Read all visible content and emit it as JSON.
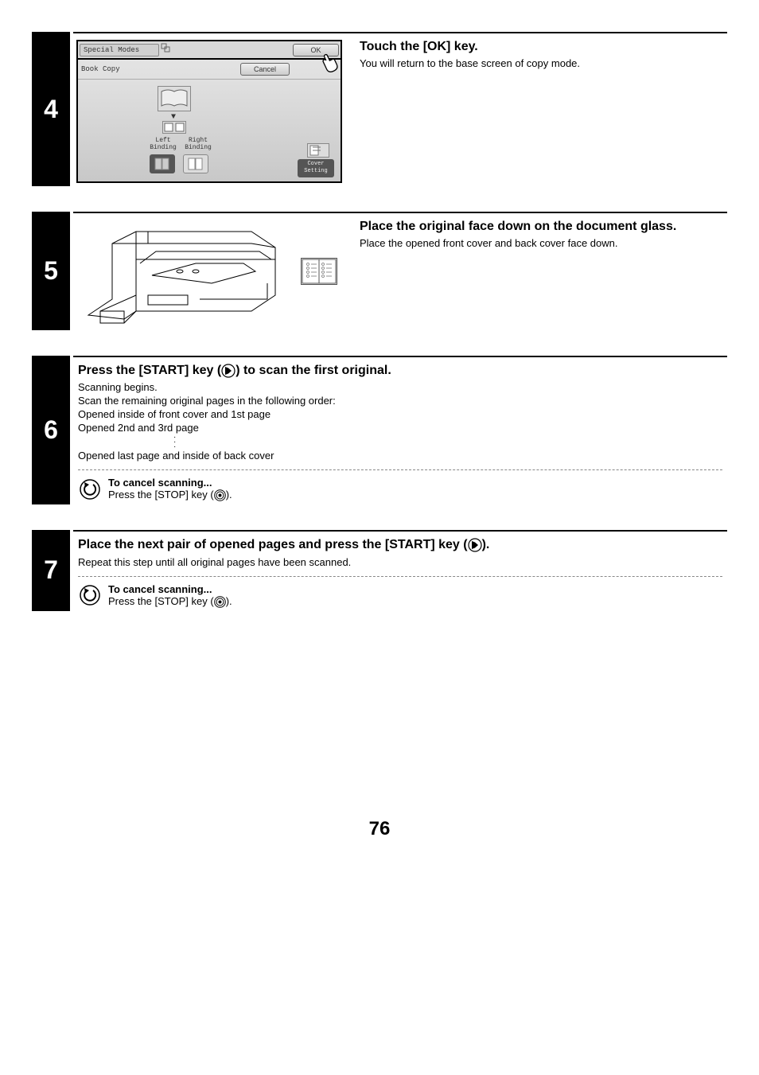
{
  "steps": {
    "4": {
      "number": "4",
      "heading": "Touch the [OK] key.",
      "body": "You will return to the base screen of copy mode.",
      "panel": {
        "tab": "Special Modes",
        "ok": "OK",
        "title": "Book Copy",
        "cancel": "Cancel",
        "left_binding": "Left Binding",
        "right_binding": "Right Binding",
        "cover_setting": "Cover Setting"
      }
    },
    "5": {
      "number": "5",
      "heading": "Place the original face down on the document glass.",
      "body": "Place the opened front cover and back cover face down."
    },
    "6": {
      "number": "6",
      "heading_pre": "Press the [START] key (",
      "heading_post": ") to scan the first original.",
      "body_lines": [
        "Scanning begins.",
        "Scan the remaining original pages in the following order:",
        "Opened inside of front cover and 1st page",
        "Opened 2nd and 3rd page"
      ],
      "body_last": "Opened last page and inside of back cover",
      "cancel_title": "To cancel scanning...",
      "cancel_pre": "Press the [STOP] key (",
      "cancel_post": ")."
    },
    "7": {
      "number": "7",
      "heading_pre": "Place the next pair of opened pages and press the [START] key (",
      "heading_post": ").",
      "body": "Repeat this step until all original pages have been scanned.",
      "cancel_title": "To cancel scanning...",
      "cancel_pre": "Press the [STOP] key (",
      "cancel_post": ")."
    }
  },
  "page_number": "76"
}
